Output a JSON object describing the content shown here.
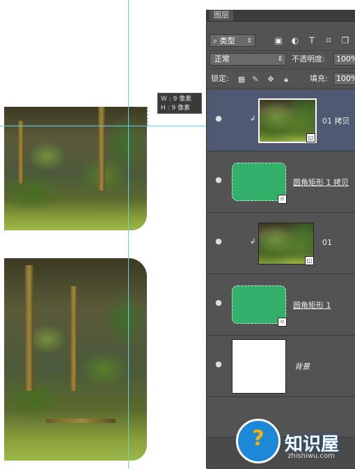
{
  "tooltip": {
    "width": "W : 9 像素",
    "height": "H : 9 像素"
  },
  "panel": {
    "tab_label": "图层",
    "filter": {
      "kind_label": "类型",
      "icons": [
        "image-filter-icon",
        "adjustment-filter-icon",
        "type-filter-icon",
        "shape-filter-icon",
        "smart-object-filter-icon"
      ]
    },
    "blend_mode": "正常",
    "opacity_label": "不透明度:",
    "opacity_value": "100%",
    "lock_label": "锁定:",
    "fill_label": "填充:",
    "fill_value": "100%"
  },
  "layers": [
    {
      "name": "01 拷贝",
      "type": "smart-object",
      "clipped": true,
      "selected": true
    },
    {
      "name": "圆角矩形 1 拷贝",
      "type": "shape",
      "clipped": false,
      "selected": false
    },
    {
      "name": "01",
      "type": "smart-object",
      "clipped": true,
      "selected": false
    },
    {
      "name": "圆角矩形 1",
      "type": "shape",
      "clipped": false,
      "selected": false
    },
    {
      "name": "背景",
      "type": "background",
      "clipped": false,
      "selected": false
    }
  ],
  "colors": {
    "shape_fill": "#33b06a",
    "selected_layer": "#4d5a72",
    "guide": "#5fd6e6"
  },
  "watermark": {
    "text": "知识屋",
    "url": "zhishiwu.com"
  }
}
